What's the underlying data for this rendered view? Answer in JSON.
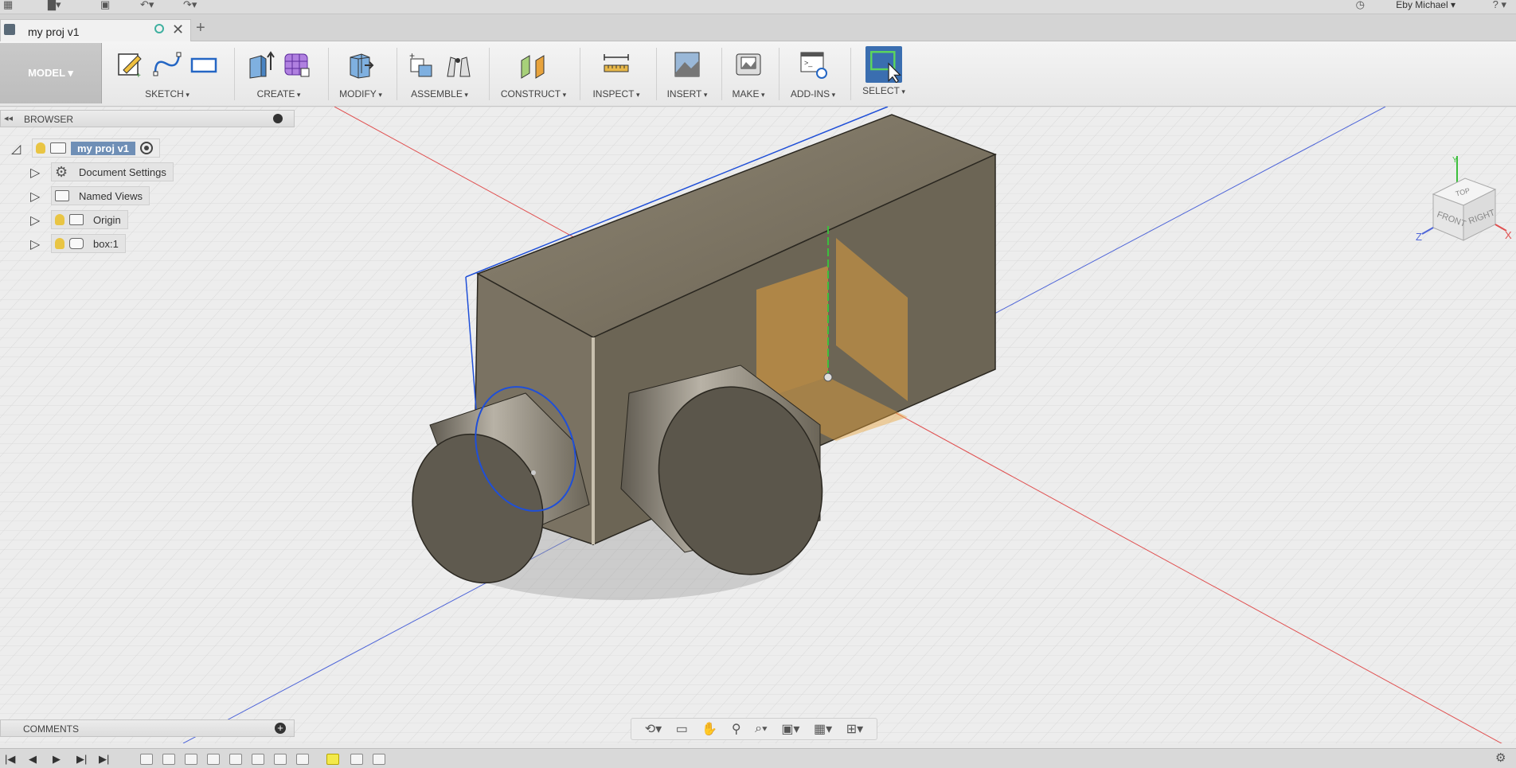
{
  "app": {
    "user_menu": "Eby Michael ▾",
    "help": "?"
  },
  "tab": {
    "title": "my proj v1",
    "new_tab": "+"
  },
  "toolbar": {
    "workspace": "MODEL ▾",
    "groups": [
      {
        "label": "SKETCH"
      },
      {
        "label": "CREATE"
      },
      {
        "label": "MODIFY"
      },
      {
        "label": "ASSEMBLE"
      },
      {
        "label": "CONSTRUCT"
      },
      {
        "label": "INSPECT"
      },
      {
        "label": "INSERT"
      },
      {
        "label": "MAKE"
      },
      {
        "label": "ADD-INS"
      },
      {
        "label": "SELECT"
      }
    ]
  },
  "browser": {
    "title": "BROWSER",
    "root": "my proj v1",
    "items": [
      {
        "label": "Document Settings"
      },
      {
        "label": "Named Views"
      },
      {
        "label": "Origin"
      },
      {
        "label": "box:1"
      }
    ]
  },
  "viewcube": {
    "top": "TOP",
    "front": "FRONT",
    "right": "RIGHT",
    "axis_x": "X",
    "axis_y": "Y",
    "axis_z": "Z"
  },
  "comments": {
    "title": "COMMENTS",
    "add": "+"
  },
  "colors": {
    "accent": "#4f7fbd",
    "body": "#6e6656",
    "origin_plane": "#e8a33c",
    "sketch_line": "#1f4fd8"
  }
}
